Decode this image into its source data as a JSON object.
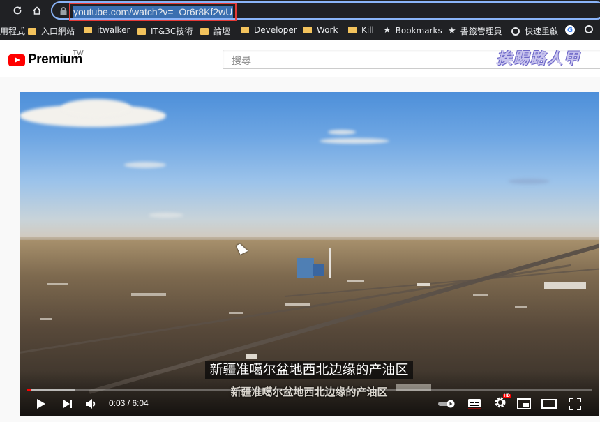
{
  "browser": {
    "url": "youtube.com/watch?v=_Or6r8Kf2wU",
    "bookmarks": [
      {
        "label": "用程式",
        "type": "plain"
      },
      {
        "label": "入口網站",
        "type": "folder"
      },
      {
        "label": "itwalker",
        "type": "folder"
      },
      {
        "label": "IT&3C技術",
        "type": "folder"
      },
      {
        "label": "論壇",
        "type": "folder"
      },
      {
        "label": "Developer",
        "type": "folder"
      },
      {
        "label": "Work",
        "type": "folder"
      },
      {
        "label": "Kill",
        "type": "folder"
      },
      {
        "label": "Bookmarks",
        "type": "star"
      },
      {
        "label": "書籤管理員",
        "type": "star"
      },
      {
        "label": "快速重啟",
        "type": "globe"
      }
    ]
  },
  "youtube": {
    "brand": "Premium",
    "region": "TW",
    "search_placeholder": "搜尋",
    "watermark": "挨踢路人甲"
  },
  "player": {
    "subtitle": "新疆准噶尔盆地西北边缘的产油区",
    "burned_caption": "新疆准噶尔盆地西北边缘的产油区",
    "current_time": "0:03",
    "separator": " / ",
    "duration": "6:04",
    "played_fraction": 0.008,
    "loaded_fraction": 0.085,
    "accent_color": "#ff0000"
  }
}
